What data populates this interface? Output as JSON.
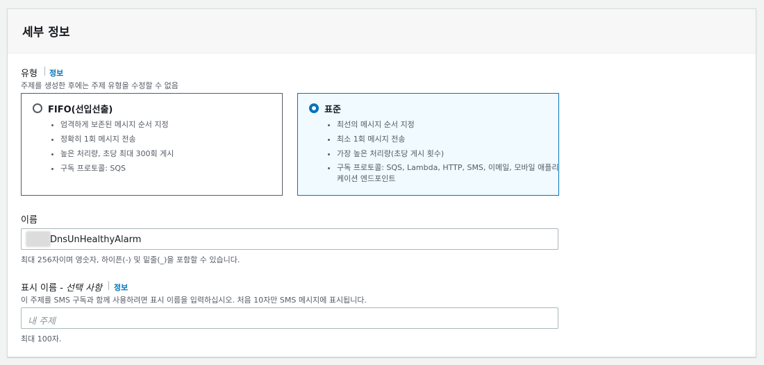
{
  "section": {
    "title": "세부 정보"
  },
  "type_field": {
    "label": "유형",
    "info": "정보",
    "description": "주제를 생성한 후에는 주제 유형을 수정할 수 없음",
    "options": [
      {
        "title": "FIFO(선입선출)",
        "selected": false,
        "bullets": [
          "엄격하게 보존된 메시지 순서 지정",
          "정확히 1회 메시지 전송",
          "높은 처리량, 초당 최대 300회 게시",
          "구독 프로토콜: SQS"
        ]
      },
      {
        "title": "표준",
        "selected": true,
        "bullets": [
          "최선의 메시지 순서 지정",
          "최소 1회 메시지 전송",
          "가장 높은 처리량(초당 게시 횟수)",
          "구독 프로토콜: SQS, Lambda, HTTP, SMS, 이메일, 모바일 애플리케이션 엔드포인트"
        ]
      }
    ]
  },
  "name_field": {
    "label": "이름",
    "value": "DnsUnHealthyAlarm",
    "hint": "최대 256자이며 영숫자, 하이픈(-) 및 밑줄(_)을 포함할 수 있습니다."
  },
  "display_name_field": {
    "label": "표시 이름",
    "optional": "- 선택 사항",
    "info": "정보",
    "description": "이 주제를 SMS 구독과 함께 사용하려면 표시 이름을 입력하십시오. 처음 10자만 SMS 메시지에 표시됩니다.",
    "placeholder": "내 주제",
    "hint": "최대 100자."
  },
  "colors": {
    "accent": "#0073bb",
    "selected_bg": "#f1faff"
  }
}
